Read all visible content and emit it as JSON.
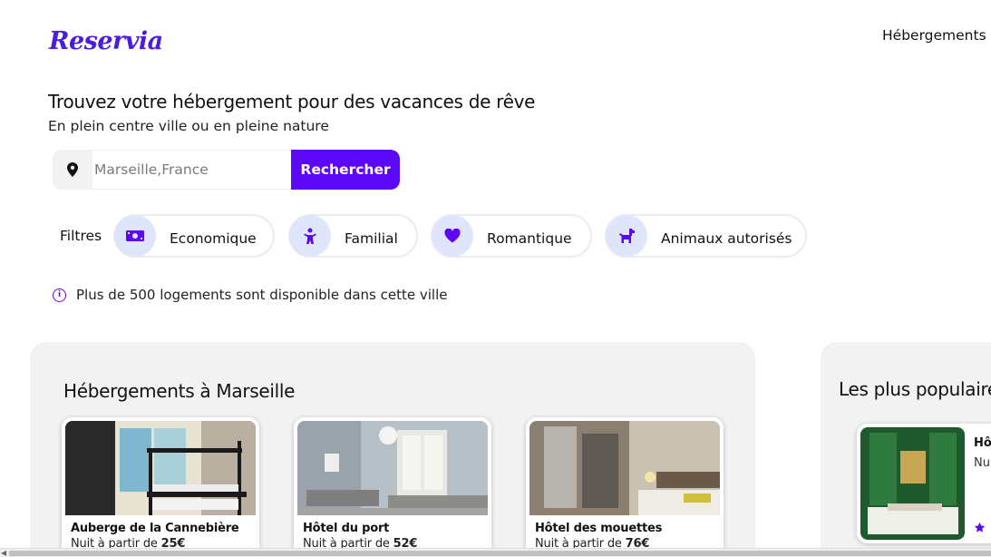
{
  "header": {
    "logo": "Reservia",
    "nav": [
      "Hébergements"
    ]
  },
  "hero": {
    "title": "Trouvez votre hébergement pour des vacances de rêve",
    "subtitle": "En plein centre ville ou en pleine nature"
  },
  "search": {
    "icon": "map-pin-icon",
    "placeholder": "Marseille,France",
    "value": "",
    "button_label": "Rechercher"
  },
  "filters": {
    "label": "Filtres",
    "items": [
      {
        "label": "Economique",
        "icon": "money-icon"
      },
      {
        "label": "Familial",
        "icon": "child-icon"
      },
      {
        "label": "Romantique",
        "icon": "heart-icon"
      },
      {
        "label": "Animaux autorisés",
        "icon": "dog-icon"
      }
    ]
  },
  "info": {
    "icon": "info-icon",
    "text": "Plus de 500 logements sont disponible dans cette ville"
  },
  "lodgings": {
    "title": "Hébergements à Marseille",
    "cards": [
      {
        "name": "Auberge de la Cannebière",
        "price_prefix": "Nuit à partir de ",
        "price": "25€"
      },
      {
        "name": "Hôtel du port",
        "price_prefix": "Nuit à partir de ",
        "price": "52€"
      },
      {
        "name": "Hôtel des mouettes",
        "price_prefix": "Nuit à partir de ",
        "price": "76€"
      }
    ]
  },
  "popular": {
    "title": "Les plus populaires",
    "cards": [
      {
        "name": "Hôt",
        "price": "Nui",
        "rating_icon": "star-icon"
      }
    ]
  },
  "colors": {
    "accent": "#5b08f7",
    "logo": "#4b1de0",
    "chip_icon_bg": "#dfe5fb",
    "panel_bg": "#f2f2f2"
  }
}
